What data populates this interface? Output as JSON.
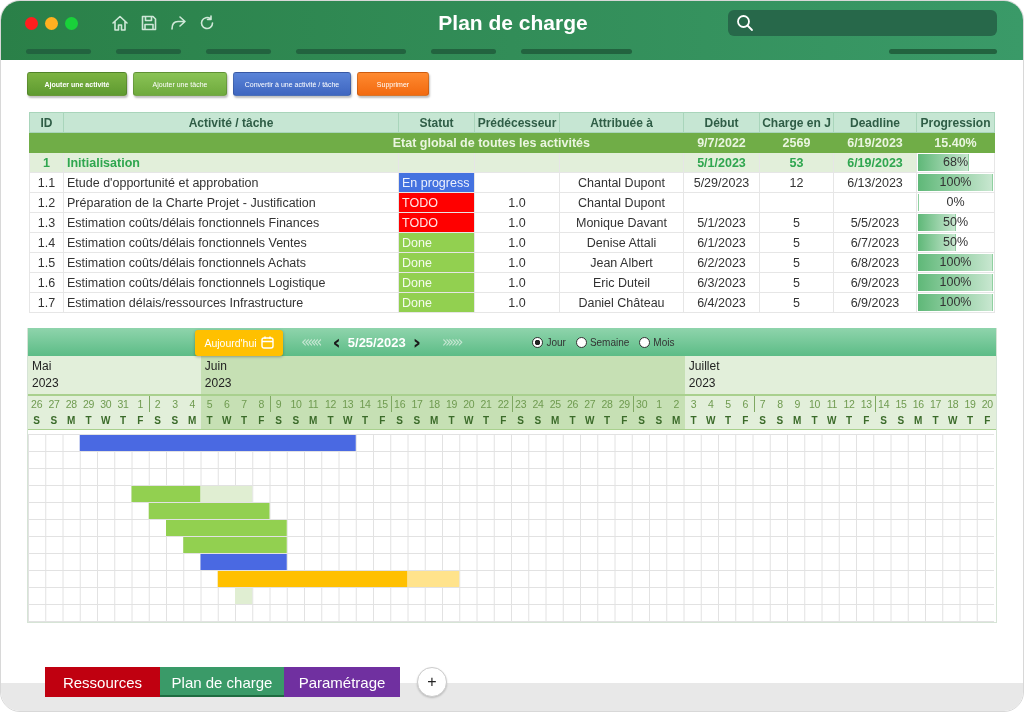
{
  "window": {
    "title": "Plan de charge"
  },
  "actions": [
    {
      "label": "Ajouter une activité",
      "kind": "primary"
    },
    {
      "label": "Ajouter une tâche",
      "kind": "secondary"
    },
    {
      "label": "Convertir à une activité / tâche",
      "kind": "convert"
    },
    {
      "label": "Supprimer",
      "kind": "delete"
    }
  ],
  "table": {
    "columns": [
      "ID",
      "Activité / tâche",
      "Statut",
      "Prédécesseur",
      "Attribuée à",
      "Début",
      "Charge en J",
      "Deadline",
      "Progression"
    ],
    "summary": {
      "label": "Etat global de toutes les activités",
      "debut": "9/7/2022",
      "charge": "2569",
      "deadline": "6/19/2023",
      "progression": "15.40%"
    },
    "rows": [
      {
        "kind": "group",
        "id": "1",
        "name": "Initialisation",
        "debut": "5/1/2023",
        "charge": "53",
        "deadline": "6/19/2023",
        "progression": "68%",
        "level": 0.68
      },
      {
        "kind": "task",
        "id": "1.1",
        "name": "Etude d'opportunité et approbation",
        "status": "En progress",
        "color": "#4472e0",
        "assignee": "Chantal Dupont",
        "debut": "5/29/2023",
        "charge": "12",
        "deadline": "6/13/2023",
        "progression": "100%",
        "level": 1
      },
      {
        "kind": "task",
        "id": "1.2",
        "name": "Préparation de la Charte Projet - Justification",
        "status": "TODO",
        "color": "#ff0000",
        "predecessor": "1.0",
        "assignee": "Chantal Dupont",
        "progression": "0%",
        "level": 0
      },
      {
        "kind": "task",
        "id": "1.3",
        "name": "Estimation coûts/délais fonctionnels Finances",
        "status": "TODO",
        "color": "#ff0000",
        "predecessor": "1.0",
        "assignee": "Monique Davant",
        "debut": "5/1/2023",
        "charge": "5",
        "deadline": "5/5/2023",
        "progression": "50%",
        "level": 0.5
      },
      {
        "kind": "task",
        "id": "1.4",
        "name": "Estimation coûts/délais fonctionnels Ventes",
        "status": "Done",
        "color": "#92d050",
        "predecessor": "1.0",
        "assignee": "Denise Attali",
        "debut": "6/1/2023",
        "charge": "5",
        "deadline": "6/7/2023",
        "progression": "50%",
        "level": 0.5
      },
      {
        "kind": "task",
        "id": "1.5",
        "name": "Estimation coûts/délais fonctionnels Achats",
        "status": "Done",
        "color": "#92d050",
        "predecessor": "1.0",
        "assignee": "Jean Albert",
        "debut": "6/2/2023",
        "charge": "5",
        "deadline": "6/8/2023",
        "progression": "100%",
        "level": 1
      },
      {
        "kind": "task",
        "id": "1.6",
        "name": "Estimation coûts/délais fonctionnels Logistique",
        "status": "Done",
        "color": "#92d050",
        "predecessor": "1.0",
        "assignee": "Eric Duteil",
        "debut": "6/3/2023",
        "charge": "5",
        "deadline": "6/9/2023",
        "progression": "100%",
        "level": 1
      },
      {
        "kind": "task",
        "id": "1.7",
        "name": "Estimation délais/ressources Infrastructure",
        "status": "Done",
        "color": "#92d050",
        "predecessor": "1.0",
        "assignee": "Daniel Château",
        "debut": "6/4/2023",
        "charge": "5",
        "deadline": "6/9/2023",
        "progression": "100%",
        "level": 1
      }
    ]
  },
  "gantt": {
    "today_button": "Aujourd'hui",
    "fast_back": "«««",
    "prev": "‹",
    "date": "5/25/2023",
    "next": "›",
    "scales": [
      {
        "label": "Jour",
        "selected": true
      },
      {
        "label": "Semaine",
        "selected": false
      },
      {
        "label": "Mois",
        "selected": false
      }
    ],
    "months": [
      {
        "name": "Mai",
        "year": "2023",
        "days": [
          {
            "n": "26",
            "d": "S",
            "week_start": false
          },
          {
            "n": "27",
            "d": "S",
            "week_start": false
          },
          {
            "n": "28",
            "d": "M",
            "week_start": false
          },
          {
            "n": "29",
            "d": "T",
            "week_start": false
          },
          {
            "n": "30",
            "d": "W",
            "week_start": false
          },
          {
            "n": "31",
            "d": "T",
            "week_start": false
          },
          {
            "n": "1",
            "d": "F",
            "week_start": false
          },
          {
            "n": "2",
            "d": "S",
            "week_start": true
          },
          {
            "n": "3",
            "d": "S",
            "week_start": false
          },
          {
            "n": "4",
            "d": "M",
            "week_start": false
          }
        ]
      },
      {
        "name": "Juin",
        "year": "2023",
        "days": [
          {
            "n": "5",
            "d": "T",
            "week_start": false
          },
          {
            "n": "6",
            "d": "W",
            "week_start": false
          },
          {
            "n": "7",
            "d": "T",
            "week_start": false
          },
          {
            "n": "8",
            "d": "F",
            "week_start": false
          },
          {
            "n": "9",
            "d": "S",
            "week_start": true
          },
          {
            "n": "10",
            "d": "S",
            "week_start": false
          },
          {
            "n": "11",
            "d": "M",
            "week_start": false
          },
          {
            "n": "12",
            "d": "T",
            "week_start": false
          },
          {
            "n": "13",
            "d": "W",
            "week_start": false
          },
          {
            "n": "14",
            "d": "T",
            "week_start": false
          },
          {
            "n": "15",
            "d": "F",
            "week_start": false
          },
          {
            "n": "16",
            "d": "S",
            "week_start": true
          },
          {
            "n": "17",
            "d": "S",
            "week_start": false
          },
          {
            "n": "18",
            "d": "M",
            "week_start": false
          },
          {
            "n": "19",
            "d": "T",
            "week_start": false
          },
          {
            "n": "20",
            "d": "W",
            "week_start": false
          },
          {
            "n": "21",
            "d": "T",
            "week_start": false
          },
          {
            "n": "22",
            "d": "F",
            "week_start": false
          },
          {
            "n": "23",
            "d": "S",
            "week_start": true
          },
          {
            "n": "24",
            "d": "S",
            "week_start": false
          },
          {
            "n": "25",
            "d": "M",
            "week_start": false
          },
          {
            "n": "26",
            "d": "T",
            "week_start": false
          },
          {
            "n": "27",
            "d": "W",
            "week_start": false
          },
          {
            "n": "28",
            "d": "T",
            "week_start": false
          },
          {
            "n": "29",
            "d": "F",
            "week_start": false
          },
          {
            "n": "30",
            "d": "S",
            "week_start": true
          },
          {
            "n": "1",
            "d": "S",
            "week_start": false
          },
          {
            "n": "2",
            "d": "M",
            "week_start": false
          }
        ]
      },
      {
        "name": "Juillet",
        "year": "2023",
        "days": [
          {
            "n": "3",
            "d": "T",
            "week_start": false
          },
          {
            "n": "4",
            "d": "W",
            "week_start": false
          },
          {
            "n": "5",
            "d": "T",
            "week_start": false
          },
          {
            "n": "6",
            "d": "F",
            "week_start": false
          },
          {
            "n": "7",
            "d": "S",
            "week_start": true
          },
          {
            "n": "8",
            "d": "S",
            "week_start": false
          },
          {
            "n": "9",
            "d": "M",
            "week_start": false
          },
          {
            "n": "10",
            "d": "T",
            "week_start": false
          },
          {
            "n": "11",
            "d": "W",
            "week_start": false
          },
          {
            "n": "12",
            "d": "T",
            "week_start": false
          },
          {
            "n": "13",
            "d": "F",
            "week_start": false
          },
          {
            "n": "14",
            "d": "S",
            "week_start": true
          },
          {
            "n": "15",
            "d": "S",
            "week_start": false
          },
          {
            "n": "16",
            "d": "M",
            "week_start": false
          },
          {
            "n": "17",
            "d": "T",
            "week_start": false
          },
          {
            "n": "18",
            "d": "W",
            "week_start": false
          },
          {
            "n": "19",
            "d": "T",
            "week_start": false
          },
          {
            "n": "20",
            "d": "F",
            "week_start": false
          }
        ]
      }
    ],
    "fast_forward_end": "»»»"
  },
  "sheets": [
    {
      "label": "Ressources",
      "kind": "resources",
      "selected": false
    },
    {
      "label": "Plan de charge",
      "kind": "plan",
      "selected": true
    },
    {
      "label": "Paramétrage",
      "kind": "settings",
      "selected": false
    }
  ],
  "add_sheet": "+"
}
